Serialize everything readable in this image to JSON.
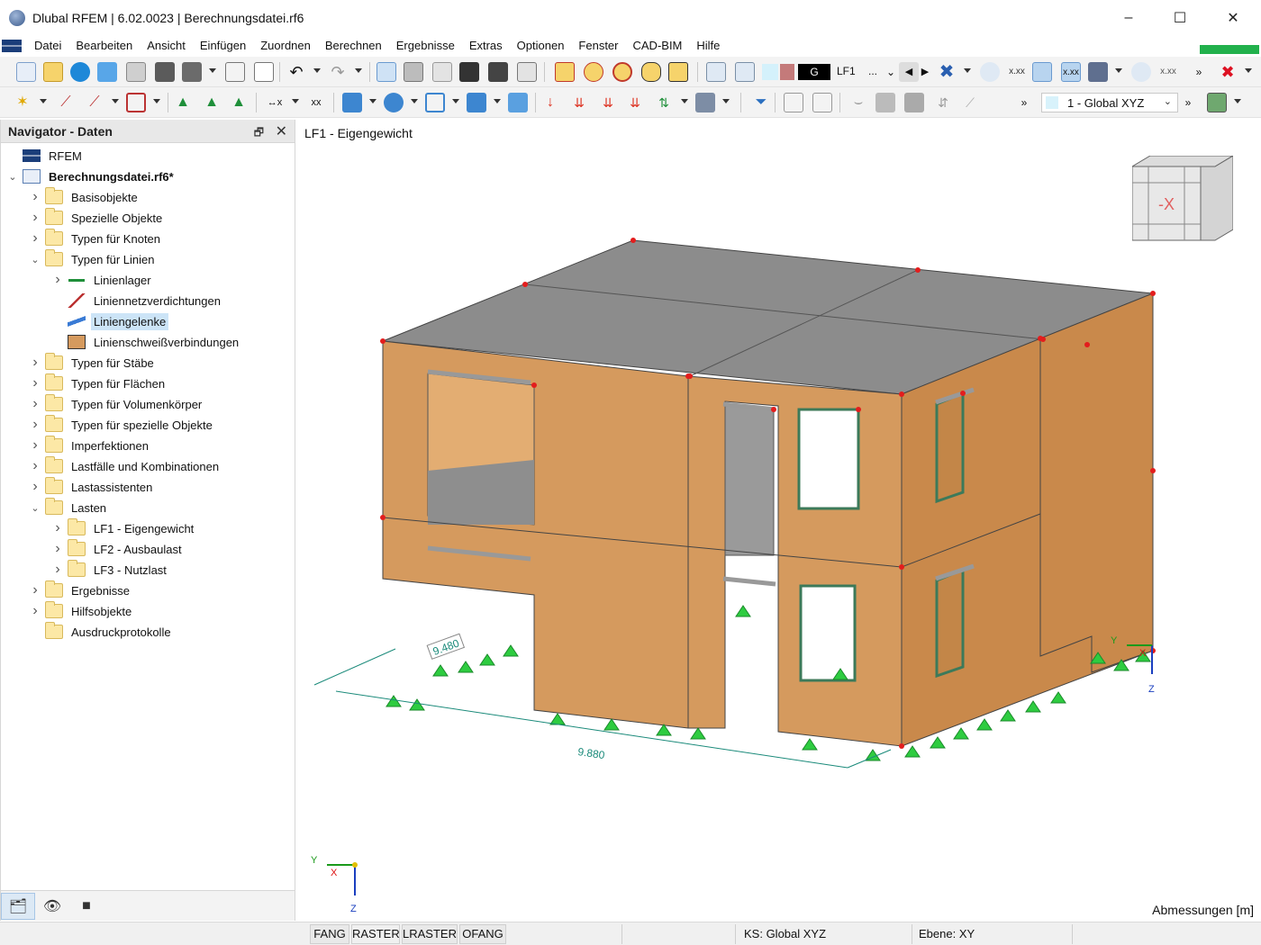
{
  "window": {
    "title": "Dlubal RFEM | 6.02.0023 | Berechnungsdatei.rf6",
    "minimize": "–",
    "maximize": "☐",
    "close": "✕"
  },
  "menu": [
    "Datei",
    "Bearbeiten",
    "Ansicht",
    "Einfügen",
    "Zuordnen",
    "Berechnen",
    "Ergebnisse",
    "Extras",
    "Optionen",
    "Fenster",
    "CAD-BIM",
    "Hilfe"
  ],
  "toolbar": {
    "load_case_color": "G",
    "load_case": "LF1",
    "load_case_more": "...",
    "view_select": "1 - Global XYZ"
  },
  "navigator": {
    "title": "Navigator - Daten",
    "pin": "🗗",
    "close": "✕",
    "tree": [
      {
        "label": "RFEM",
        "level": 0,
        "icon": "rfem-logo",
        "expander": ""
      },
      {
        "label": "Berechnungsdatei.rf6*",
        "level": 0,
        "icon": "model-file",
        "expander": "v",
        "bold": true
      },
      {
        "label": "Basisobjekte",
        "level": 1,
        "icon": "folder",
        "expander": ">"
      },
      {
        "label": "Spezielle Objekte",
        "level": 1,
        "icon": "folder",
        "expander": ">"
      },
      {
        "label": "Typen für Knoten",
        "level": 1,
        "icon": "folder",
        "expander": ">"
      },
      {
        "label": "Typen für Linien",
        "level": 1,
        "icon": "folder",
        "expander": "v"
      },
      {
        "label": "Linienlager",
        "level": 2,
        "icon": "line-support",
        "expander": ">"
      },
      {
        "label": "Liniennetzverdichtungen",
        "level": 2,
        "icon": "mesh-refinement",
        "expander": ""
      },
      {
        "label": "Liniengelenke",
        "level": 2,
        "icon": "line-hinge",
        "expander": "",
        "selected": true
      },
      {
        "label": "Linienschweißverbindungen",
        "level": 2,
        "icon": "weld",
        "expander": ""
      },
      {
        "label": "Typen für Stäbe",
        "level": 1,
        "icon": "folder",
        "expander": ">"
      },
      {
        "label": "Typen für Flächen",
        "level": 1,
        "icon": "folder",
        "expander": ">"
      },
      {
        "label": "Typen für Volumenkörper",
        "level": 1,
        "icon": "folder",
        "expander": ">"
      },
      {
        "label": "Typen für spezielle Objekte",
        "level": 1,
        "icon": "folder",
        "expander": ">"
      },
      {
        "label": "Imperfektionen",
        "level": 1,
        "icon": "folder",
        "expander": ">"
      },
      {
        "label": "Lastfälle und Kombinationen",
        "level": 1,
        "icon": "folder",
        "expander": ">"
      },
      {
        "label": "Lastassistenten",
        "level": 1,
        "icon": "folder",
        "expander": ">"
      },
      {
        "label": "Lasten",
        "level": 1,
        "icon": "folder",
        "expander": "v"
      },
      {
        "label": "LF1 - Eigengewicht",
        "level": 2,
        "icon": "folder",
        "expander": ">"
      },
      {
        "label": "LF2 - Ausbaulast",
        "level": 2,
        "icon": "folder",
        "expander": ">"
      },
      {
        "label": "LF3 - Nutzlast",
        "level": 2,
        "icon": "folder",
        "expander": ">"
      },
      {
        "label": "Ergebnisse",
        "level": 1,
        "icon": "folder",
        "expander": ">"
      },
      {
        "label": "Hilfsobjekte",
        "level": 1,
        "icon": "folder",
        "expander": ">"
      },
      {
        "label": "Ausdruckprotokolle",
        "level": 1,
        "icon": "folder",
        "expander": ""
      }
    ],
    "footer_tabs": [
      "data-icon",
      "eye-icon",
      "camera-icon"
    ]
  },
  "viewport": {
    "title": "LF1 - Eigengewicht",
    "dimension_units": "Abmessungen [m]",
    "dim_width": "9.880",
    "dim_depth": "9.480",
    "view_cube_label": "-X",
    "axis_y": "Y",
    "axis_x": "X",
    "axis_z": "Z",
    "colors": {
      "wall": "#d59a5e",
      "wall_dark": "#c38648",
      "roof": "#8c8c8c",
      "support": "#2ecc40",
      "node": "#e31d1d",
      "dimension": "#1a8a7a"
    }
  },
  "statusbar": {
    "buttons": [
      "FANG",
      "RASTER",
      "LRASTER",
      "OFANG"
    ],
    "coord_system": "KS: Global XYZ",
    "plane": "Ebene: XY"
  }
}
